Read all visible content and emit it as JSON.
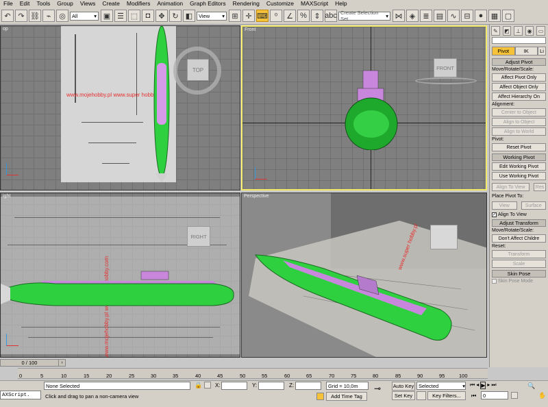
{
  "menu": [
    "File",
    "Edit",
    "Tools",
    "Group",
    "Views",
    "Create",
    "Modifiers",
    "Animation",
    "Graph Editors",
    "Rendering",
    "Customize",
    "MAXScript",
    "Help"
  ],
  "toolbar": {
    "filter_value": "All",
    "refcoord_value": "View",
    "selection_set_placeholder": "Create Selection Set"
  },
  "viewports": {
    "top_label": "op",
    "front_label": "Front",
    "left_label": "ight",
    "persp_label": "Perspective",
    "viewcube_top": "TOP",
    "viewcube_front": "FRONT",
    "viewcube_right": "RIGHT",
    "watermark_1": "www.mojehobby.pl www.super hobby.com",
    "watermark_2": "www.mojehobby.pl www.super hobby.com",
    "watermark_3": "www.super hobby.pl"
  },
  "command_panel": {
    "tabs": [
      "Pivot",
      "IK",
      "Li"
    ],
    "adjust_pivot": "Adjust Pivot",
    "move_rotate_scale": "Move/Rotate/Scale:",
    "affect_pivot_only": "Affect Pivot Only",
    "affect_object_only": "Affect Object Only",
    "affect_hierarchy_only": "Affect Hierarchy On",
    "alignment": "Alignment:",
    "center_to_object": "Center to Object",
    "align_to_object": "Align to Object",
    "align_to_world": "Align to World",
    "pivot": "Pivot:",
    "reset_pivot": "Reset Pivot",
    "working_pivot": "Working Pivot",
    "edit_working_pivot": "Edit Working Pivot",
    "use_working_pivot": "Use Working Pivot",
    "align_to_view": "Align To View",
    "reset": "Res",
    "place_pivot_to": "Place Pivot To:",
    "view": "View",
    "surface": "Surface",
    "align_to_view_check": "Align To View",
    "adjust_transform": "Adjust Transform",
    "move_rotate_scale_2": "Move/Rotate/Scale:",
    "dont_affect_children": "Don't Affect Childre",
    "reset_label": "Reset:",
    "transform": "Transform",
    "scale": "Scale",
    "skin_pose": "Skin Pose",
    "skin_pose_mode": "Skin Pose Mode"
  },
  "timeline": {
    "frame_display": "0 / 100",
    "ticks": [
      "0",
      "5",
      "10",
      "15",
      "20",
      "25",
      "30",
      "35",
      "40",
      "45",
      "50",
      "55",
      "60",
      "65",
      "70",
      "75",
      "80",
      "85",
      "90",
      "95",
      "100"
    ]
  },
  "status": {
    "selection": "None Selected",
    "prompt": "Click and drag to pan a non-camera view",
    "x_label": "X:",
    "y_label": "Y:",
    "z_label": "Z:",
    "grid": "Grid = 10,0m",
    "add_time_tag": "Add Time Tag",
    "auto_key": "Auto Key",
    "set_key": "Set Key",
    "selected": "Selected",
    "key_filters": "Key Filters...",
    "frame_field": "0",
    "maxscript": "AXScript."
  }
}
